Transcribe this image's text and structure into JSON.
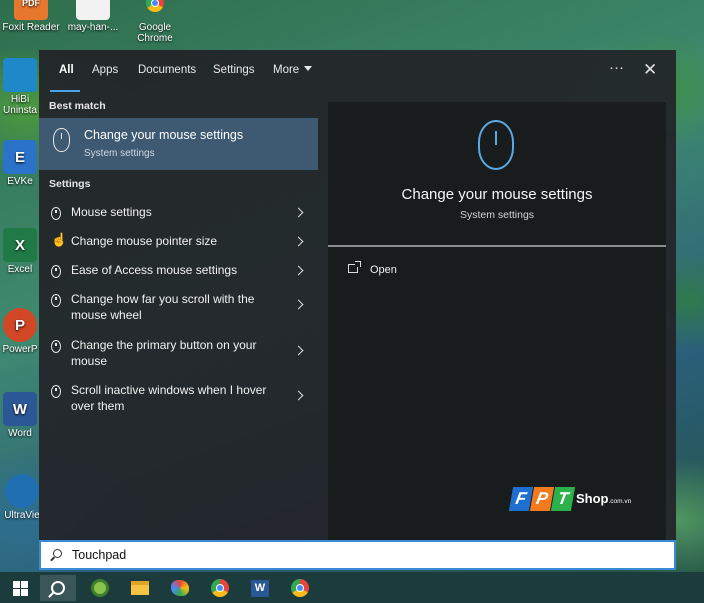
{
  "desktop": {
    "icons": [
      {
        "label": "Foxit Reader",
        "badge": "PDF",
        "color": "#e8772e"
      },
      {
        "label": "may-han-...",
        "badge": "",
        "color": "#f2f2f2"
      },
      {
        "label": "Google Chrome",
        "badge": "",
        "color": "#ffffff"
      },
      {
        "label": "HiBi Uninsta",
        "badge": "",
        "color": "#1e88c8"
      },
      {
        "label": "EVKe",
        "badge": "E",
        "color": "#2a73c9"
      },
      {
        "label": "Excel",
        "badge": "X",
        "color": "#1f7a45"
      },
      {
        "label": "PowerP",
        "badge": "P",
        "color": "#d24726"
      },
      {
        "label": "Word",
        "badge": "W",
        "color": "#2b5797"
      },
      {
        "label": "UltraVie",
        "badge": "",
        "color": "#1f6fb2"
      }
    ]
  },
  "search_panel": {
    "tabs": [
      "All",
      "Apps",
      "Documents",
      "Settings",
      "More"
    ],
    "more_icon": "ellipsis-icon",
    "close_icon": "close-icon",
    "best_match": {
      "heading": "Best match",
      "title": "Change your mouse settings",
      "subtitle": "System settings",
      "icon": "mouse-icon"
    },
    "settings": {
      "heading": "Settings",
      "items": [
        {
          "label": "Mouse settings",
          "icon": "mouse-icon"
        },
        {
          "label": "Change mouse pointer size",
          "icon": "pointer-hand-icon"
        },
        {
          "label": "Ease of Access mouse settings",
          "icon": "mouse-icon"
        },
        {
          "label": "Change how far you scroll with the mouse wheel",
          "icon": "mouse-icon"
        },
        {
          "label": "Change the primary button on your mouse",
          "icon": "mouse-icon"
        },
        {
          "label": "Scroll inactive windows when I hover over them",
          "icon": "mouse-icon"
        }
      ]
    },
    "preview": {
      "title": "Change your mouse settings",
      "subtitle": "System settings",
      "action_open": "Open",
      "action_icon": "open-external-icon"
    },
    "watermark": {
      "letters": [
        "F",
        "P",
        "T"
      ],
      "shop": "Shop",
      "domain": ".com.vn",
      "colors": [
        "#1f6fd1",
        "#f47a20",
        "#2bb24c"
      ]
    }
  },
  "search": {
    "value": "Touchpad",
    "icon": "search-icon"
  },
  "taskbar": {
    "items": [
      "start-button",
      "search-button",
      "app-icon",
      "file-explorer-icon",
      "paint-icon",
      "chrome-icon",
      "word-icon",
      "chrome-profile-icon"
    ],
    "accent": "#1b3b3d"
  }
}
